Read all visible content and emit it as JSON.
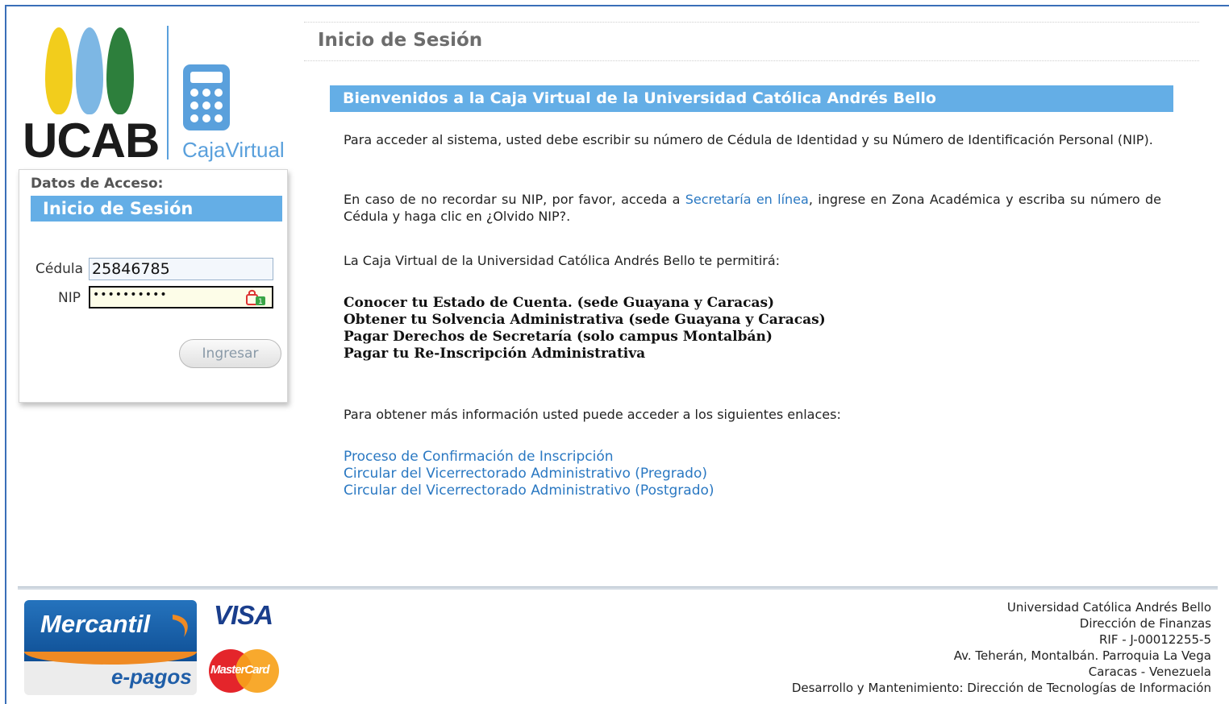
{
  "logo": {
    "brand": "UCAB",
    "product": "CajaVirtual",
    "flame_colors": [
      "#f2cd1c",
      "#7db7e4",
      "#2d7f3c"
    ]
  },
  "login": {
    "section_label": "Datos de Acceso:",
    "title": "Inicio de Sesión",
    "cedula_label": "Cédula",
    "cedula_value": "25846785",
    "nip_label": "NIP",
    "nip_value": "••••••••••",
    "submit_label": "Ingresar"
  },
  "main": {
    "page_title": "Inicio de Sesión",
    "welcome": "Bienvenidos a la Caja Virtual de la Universidad Católica Andrés Bello",
    "intro": "Para acceder al sistema, usted debe escribir su número de Cédula de Identidad y su Número de Identificación Personal (NIP).",
    "forgot_prefix": "En caso de no recordar su NIP, por favor, acceda a ",
    "forgot_link": "Secretaría en línea",
    "forgot_suffix": ", ingrese en Zona Académica y escriba su número de Cédula y haga clic en ¿Olvido NIP?.",
    "allows": "La Caja Virtual de la Universidad Católica Andrés Bello te permitirá:",
    "benefits": [
      "Conocer tu Estado de Cuenta. (sede Guayana y Caracas)",
      "Obtener tu Solvencia Administrativa (sede Guayana y Caracas)",
      "Pagar Derechos de Secretaría (solo campus Montalbán)",
      "Pagar tu Re-Inscripción Administrativa"
    ],
    "more_info": "Para obtener más información usted puede acceder a los siguientes enlaces:",
    "links": [
      "Proceso de Confirmación de Inscripción",
      "Circular del Vicerrectorado Administrativo (Pregrado)",
      "Circular del Vicerrectorado Administrativo (Postgrado)"
    ]
  },
  "footer": {
    "mercantil": "Mercantil",
    "epagos": "e-pagos",
    "visa": "VISA",
    "mastercard": "MasterCard",
    "info": [
      "Universidad Católica Andrés Bello",
      "Dirección de Finanzas",
      "RIF - J-00012255-5",
      "Av. Teherán, Montalbán. Parroquia La Vega",
      "Caracas - Venezuela",
      "Desarrollo y Mantenimiento: Dirección de Tecnologías de Información"
    ]
  }
}
